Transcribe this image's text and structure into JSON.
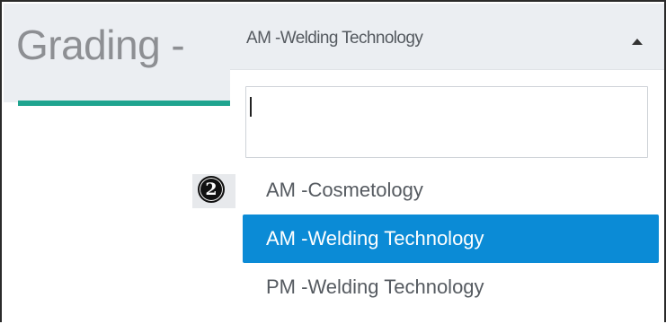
{
  "header": {
    "title": "Grading -"
  },
  "dropdown": {
    "selected_value": "AM -Welding Technology",
    "expanded": true,
    "search_value": "",
    "options": [
      {
        "label": "AM -Cosmetology",
        "selected": false
      },
      {
        "label": "AM -Welding Technology",
        "selected": true
      },
      {
        "label": "PM -Welding Technology",
        "selected": false
      }
    ]
  },
  "annotation": {
    "step_number": "2"
  },
  "colors": {
    "accent_bar": "#1fa48f",
    "selected_option": "#0b8bd6",
    "header_bg": "#ebeef2",
    "title_text": "#8d8f93"
  },
  "icons": {
    "dropdown_caret": "caret-up-icon",
    "step_marker": "numbered-circle-icon"
  }
}
